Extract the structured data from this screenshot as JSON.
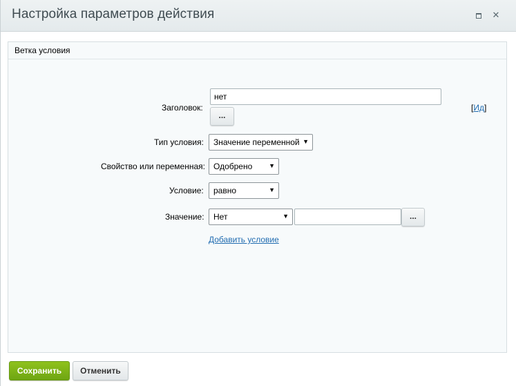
{
  "dialog": {
    "title": "Настройка параметров действия",
    "maximize_icon": "maximize-icon",
    "close_icon": "close-icon",
    "close_glyph": "✕"
  },
  "panel": {
    "title": "Ветка условия"
  },
  "form": {
    "heading_label": "Заголовок:",
    "heading_value": "нет",
    "heading_dots": "...",
    "id_link_open": "[",
    "id_link": "Ид",
    "id_link_close": "]",
    "condition_type_label": "Тип условия:",
    "condition_type_value": "Значение переменной",
    "property_label": "Свойство или переменная:",
    "property_value": "Одобрено",
    "condition_label": "Условие:",
    "condition_value": "равно",
    "value_label": "Значение:",
    "value_select": "Нет",
    "value_input": "",
    "value_dots": "...",
    "add_condition": "Добавить условие"
  },
  "footer": {
    "save": "Сохранить",
    "cancel": "Отменить"
  },
  "colors": {
    "accent_green": "#7bb316",
    "link_blue": "#1f6bb0",
    "title_bar": "#e8edef"
  }
}
